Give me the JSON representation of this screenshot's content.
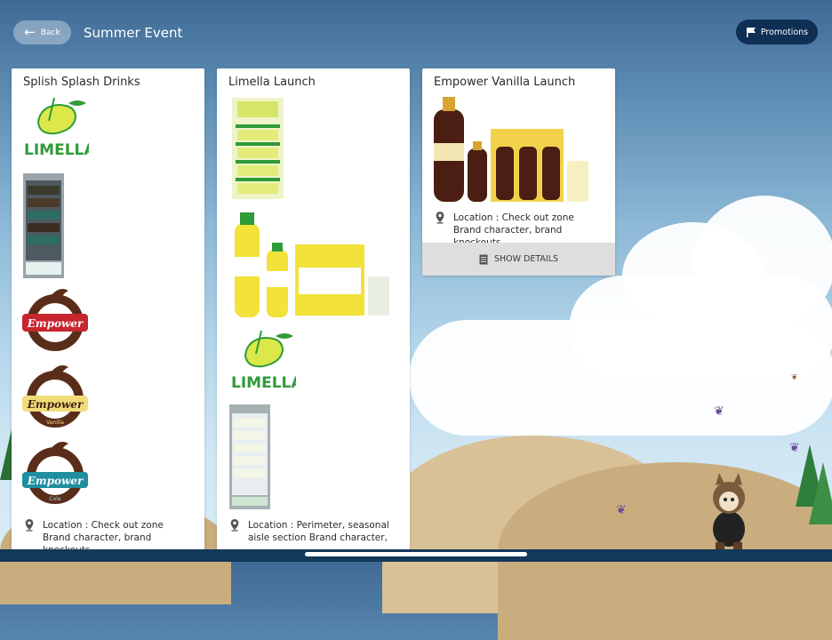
{
  "header": {
    "back_label": "Back",
    "title": "Summer Event",
    "promotions_label": "Promotions"
  },
  "cards": [
    {
      "title": "Splish Splash Drinks",
      "location": "Location : Check out zone Brand character, brand knockouts",
      "images": [
        "limella-logo",
        "cooler-dark",
        "empower-cola-red-logo",
        "empower-vanilla-logo",
        "empower-cola-logo"
      ]
    },
    {
      "title": "Limella Launch",
      "location": "Location : Perimeter, seasonal aisle section Brand character,",
      "images": [
        "limella-shelf-display",
        "limella-bottles-pack",
        "limella-logo",
        "cooler-light"
      ]
    },
    {
      "title": "Empower Vanilla Launch",
      "location": "Location : Check out zone Brand character, brand knockouts",
      "show_details_label": "SHOW DETAILS",
      "images": [
        "empower-vanilla-bottles-pack"
      ]
    }
  ],
  "logo_texts": {
    "limella": "LIMELLA",
    "empower": "Empower",
    "vanilla": "Vanilla",
    "cola": "Cola"
  },
  "colors": {
    "promo_button": "#0f2f55",
    "limella_green": "#2f9b3a",
    "empower_brown": "#5a2d1a",
    "empower_red": "#c8262e",
    "empower_teal": "#1e8ea0"
  }
}
